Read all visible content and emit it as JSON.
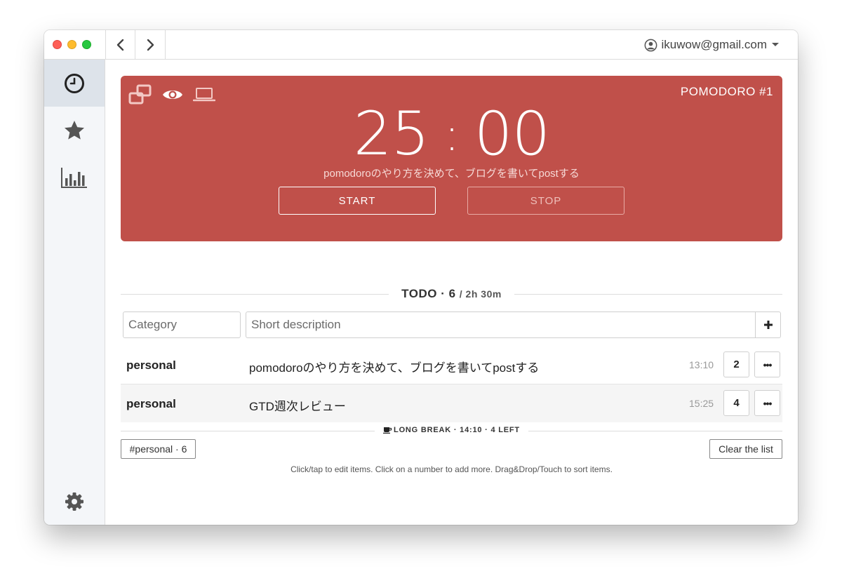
{
  "account": {
    "email": "ikuwow@gmail.com"
  },
  "timer": {
    "label": "POMODORO #1",
    "minutes": "25",
    "separator": ":",
    "seconds": "00",
    "task": "pomodoroのやり方を決めて、ブログを書いてpostする",
    "start_label": "START",
    "stop_label": "STOP"
  },
  "todo": {
    "title": "TODO · 6",
    "subtitle": "/ 2h 30m",
    "category_placeholder": "Category",
    "description_placeholder": "Short description",
    "items": [
      {
        "category": "personal",
        "description": "pomodoroのやり方を決めて、ブログを書いてpostする",
        "time": "13:10",
        "count": "2",
        "more": "•••"
      },
      {
        "category": "personal",
        "description": "GTD週次レビュー",
        "time": "15:25",
        "count": "4",
        "more": "•••"
      }
    ],
    "long_break": "LONG BREAK · 14:10 · 4 LEFT",
    "tag_filter": "#personal · 6",
    "clear_label": "Clear the list",
    "hint": "Click/tap to edit items. Click on a number to add more. Drag&Drop/Touch to sort items."
  },
  "colors": {
    "accent_red": "#c0504a",
    "sidebar_bg": "#f4f6f9",
    "sidebar_active": "#dde3ea"
  },
  "icons": {
    "sidebar": [
      "clock-icon",
      "star-icon",
      "bar-chart-icon",
      "gear-icon"
    ],
    "card": [
      "windows-icon",
      "eye-icon",
      "laptop-icon"
    ]
  }
}
